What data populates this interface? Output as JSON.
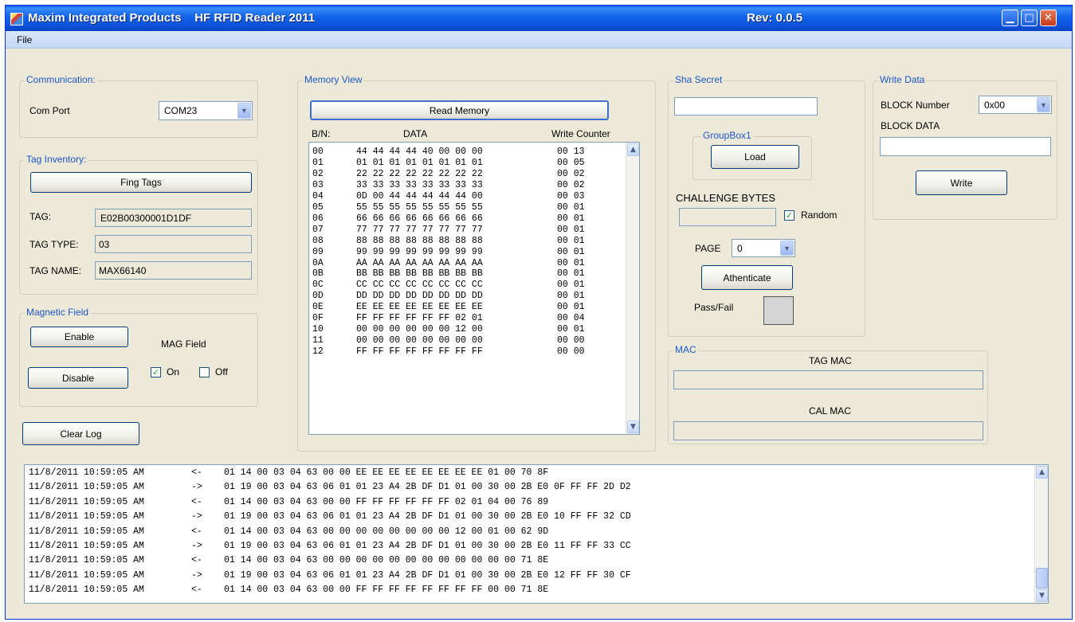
{
  "window": {
    "title": "Maxim Integrated Products    HF RFID Reader 2011",
    "rev": "Rev: 0.0.5",
    "minimize_glyph": "▁",
    "maximize_glyph": "□",
    "close_glyph": "✕"
  },
  "menu": {
    "file": "File"
  },
  "communication": {
    "title": "Communication:",
    "com_port_label": "Com Port",
    "com_port_value": "COM23"
  },
  "tag_inventory": {
    "title": "Tag Inventory:",
    "find_button": "Fing Tags",
    "tag_label": "TAG:",
    "tag_value": "E02B00300001D1DF",
    "tag_type_label": "TAG TYPE:",
    "tag_type_value": "03",
    "tag_name_label": "TAG NAME:",
    "tag_name_value": "MAX66140"
  },
  "magnetic_field": {
    "title": "Magnetic Field",
    "enable_button": "Enable",
    "disable_button": "Disable",
    "mag_field_label": "MAG Field",
    "on_label": "On",
    "off_label": "Off",
    "on_checked": true,
    "off_checked": false
  },
  "clear_log_button": "Clear Log",
  "memory_view": {
    "title": "Memory View",
    "read_button": "Read Memory",
    "col_bn": "B/N:",
    "col_data": "DATA",
    "col_write_counter": "Write Counter",
    "rows": [
      {
        "bn": "00",
        "data": "44 44 44 44 40 00 00 00",
        "wc": "00 13"
      },
      {
        "bn": "01",
        "data": "01 01 01 01 01 01 01 01",
        "wc": "00 05"
      },
      {
        "bn": "02",
        "data": "22 22 22 22 22 22 22 22",
        "wc": "00 02"
      },
      {
        "bn": "03",
        "data": "33 33 33 33 33 33 33 33",
        "wc": "00 02"
      },
      {
        "bn": "04",
        "data": "0D 00 44 44 44 44 44 00",
        "wc": "00 03"
      },
      {
        "bn": "05",
        "data": "55 55 55 55 55 55 55 55",
        "wc": "00 01"
      },
      {
        "bn": "06",
        "data": "66 66 66 66 66 66 66 66",
        "wc": "00 01"
      },
      {
        "bn": "07",
        "data": "77 77 77 77 77 77 77 77",
        "wc": "00 01"
      },
      {
        "bn": "08",
        "data": "88 88 88 88 88 88 88 88",
        "wc": "00 01"
      },
      {
        "bn": "09",
        "data": "99 99 99 99 99 99 99 99",
        "wc": "00 01"
      },
      {
        "bn": "0A",
        "data": "AA AA AA AA AA AA AA AA",
        "wc": "00 01"
      },
      {
        "bn": "0B",
        "data": "BB BB BB BB BB BB BB BB",
        "wc": "00 01"
      },
      {
        "bn": "0C",
        "data": "CC CC CC CC CC CC CC CC",
        "wc": "00 01"
      },
      {
        "bn": "0D",
        "data": "DD DD DD DD DD DD DD DD",
        "wc": "00 01"
      },
      {
        "bn": "0E",
        "data": "EE EE EE EE EE EE EE EE",
        "wc": "00 01"
      },
      {
        "bn": "0F",
        "data": "FF FF FF FF FF FF 02 01",
        "wc": "00 04"
      },
      {
        "bn": "10",
        "data": "00 00 00 00 00 00 12 00",
        "wc": "00 01"
      },
      {
        "bn": "11",
        "data": "00 00 00 00 00 00 00 00",
        "wc": "00 00"
      },
      {
        "bn": "12",
        "data": "FF FF FF FF FF FF FF FF",
        "wc": "00 00"
      }
    ]
  },
  "sha_secret": {
    "title": "Sha Secret",
    "secret_value": "",
    "groupbox1_title": "GroupBox1",
    "load_button": "Load",
    "challenge_label": "CHALLENGE BYTES",
    "challenge_value": "",
    "random_label": "Random",
    "random_checked": true,
    "page_label": "PAGE",
    "page_value": "0",
    "authenticate_button": "Athenticate",
    "pass_fail_label": "Pass/Fail"
  },
  "write_data": {
    "title": "Write Data",
    "block_number_label": "BLOCK Number",
    "block_number_value": "0x00",
    "block_data_label": "BLOCK DATA",
    "block_data_value": "",
    "write_button": "Write"
  },
  "mac": {
    "title": "MAC",
    "tag_mac_label": "TAG MAC",
    "tag_mac_value": "",
    "cal_mac_label": "CAL MAC",
    "cal_mac_value": ""
  },
  "log": {
    "rows": [
      {
        "ts": "11/8/2011 10:59:05 AM",
        "dir": "<-",
        "bytes": "01 14 00 03 04 63 00 00 EE EE EE EE EE EE EE EE 01 00 70 8F"
      },
      {
        "ts": "11/8/2011 10:59:05 AM",
        "dir": "->",
        "bytes": "01 19 00 03 04 63 06 01 01 23 A4 2B DF D1 01 00 30 00 2B E0 0F FF FF 2D D2"
      },
      {
        "ts": "11/8/2011 10:59:05 AM",
        "dir": "<-",
        "bytes": "01 14 00 03 04 63 00 00 FF FF FF FF FF FF 02 01 04 00 76 89"
      },
      {
        "ts": "11/8/2011 10:59:05 AM",
        "dir": "->",
        "bytes": "01 19 00 03 04 63 06 01 01 23 A4 2B DF D1 01 00 30 00 2B E0 10 FF FF 32 CD"
      },
      {
        "ts": "11/8/2011 10:59:05 AM",
        "dir": "<-",
        "bytes": "01 14 00 03 04 63 00 00 00 00 00 00 00 00 12 00 01 00 62 9D"
      },
      {
        "ts": "11/8/2011 10:59:05 AM",
        "dir": "->",
        "bytes": "01 19 00 03 04 63 06 01 01 23 A4 2B DF D1 01 00 30 00 2B E0 11 FF FF 33 CC"
      },
      {
        "ts": "11/8/2011 10:59:05 AM",
        "dir": "<-",
        "bytes": "01 14 00 03 04 63 00 00 00 00 00 00 00 00 00 00 00 00 71 8E"
      },
      {
        "ts": "11/8/2011 10:59:05 AM",
        "dir": "->",
        "bytes": "01 19 00 03 04 63 06 01 01 23 A4 2B DF D1 01 00 30 00 2B E0 12 FF FF 30 CF"
      },
      {
        "ts": "11/8/2011 10:59:05 AM",
        "dir": "<-",
        "bytes": "01 14 00 03 04 63 00 00 FF FF FF FF FF FF FF FF 00 00 71 8E"
      }
    ]
  },
  "icons": {
    "app": "app-icon",
    "dropdown": "chevron-down-icon",
    "check": "checkmark-icon",
    "scroll_up": "scroll-up-icon",
    "scroll_down": "scroll-down-icon"
  }
}
